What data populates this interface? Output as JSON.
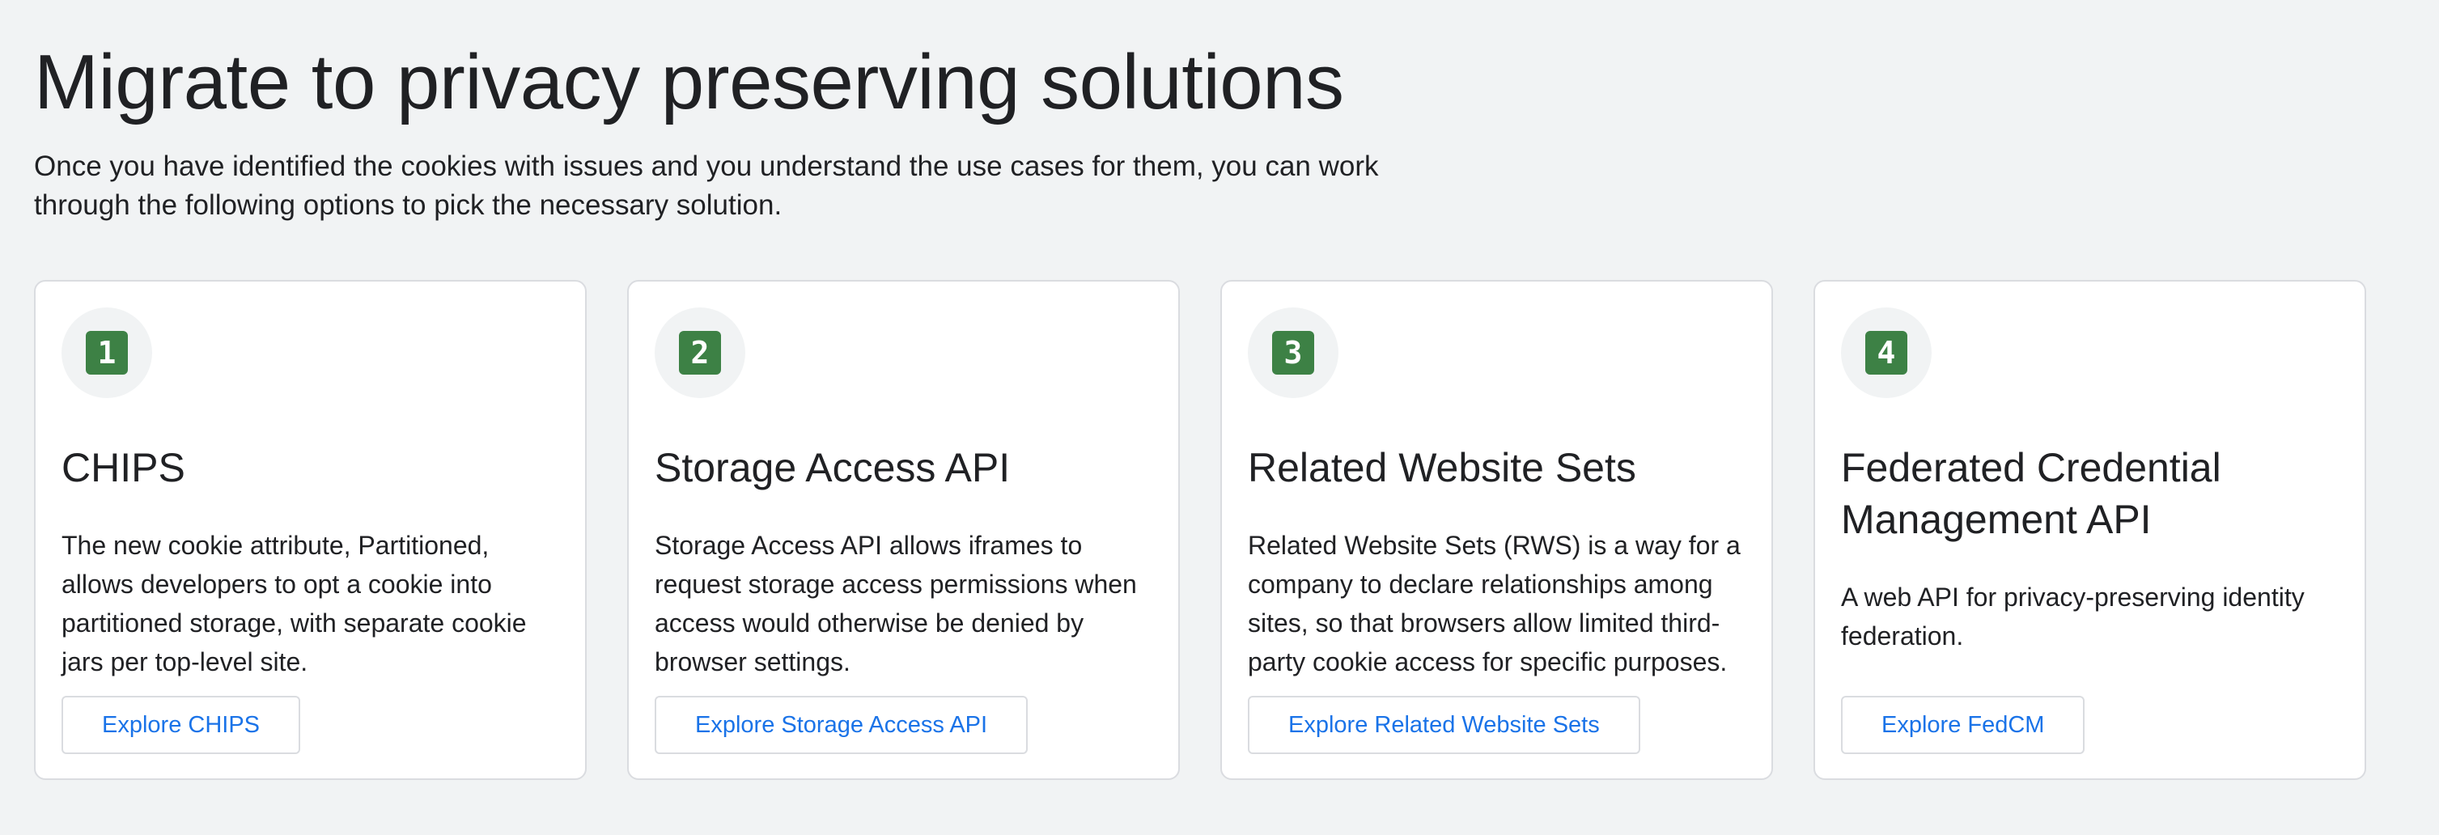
{
  "page": {
    "title": "Migrate to privacy preserving solutions",
    "intro_line1": "Once you have identified the cookies with issues and you understand the use cases for them, you can work",
    "intro_line2": "through the following options to pick the necessary solution."
  },
  "colors": {
    "background": "#f1f3f4",
    "card_background": "#ffffff",
    "badge_green": "#3d8145",
    "link_blue": "#1a73e8",
    "border": "#dadce0"
  },
  "cards": [
    {
      "number": "1",
      "title": "CHIPS",
      "description": "The new cookie attribute, Partitioned, allows developers to opt a cookie into partitioned storage, with separate cookie jars per top-level site.",
      "button": "Explore CHIPS"
    },
    {
      "number": "2",
      "title": "Storage Access API",
      "description": "Storage Access API allows iframes to request storage access permissions when access would otherwise be denied by browser settings.",
      "button": "Explore Storage Access API"
    },
    {
      "number": "3",
      "title": "Related Website Sets",
      "description": "Related Website Sets (RWS) is a way for a company to declare relationships among sites, so that browsers allow limited third-party cookie access for specific purposes.",
      "button": "Explore Related Website Sets"
    },
    {
      "number": "4",
      "title": "Federated Credential Management API",
      "description": "A web API for privacy-preserving identity federation.",
      "button": "Explore FedCM"
    }
  ]
}
